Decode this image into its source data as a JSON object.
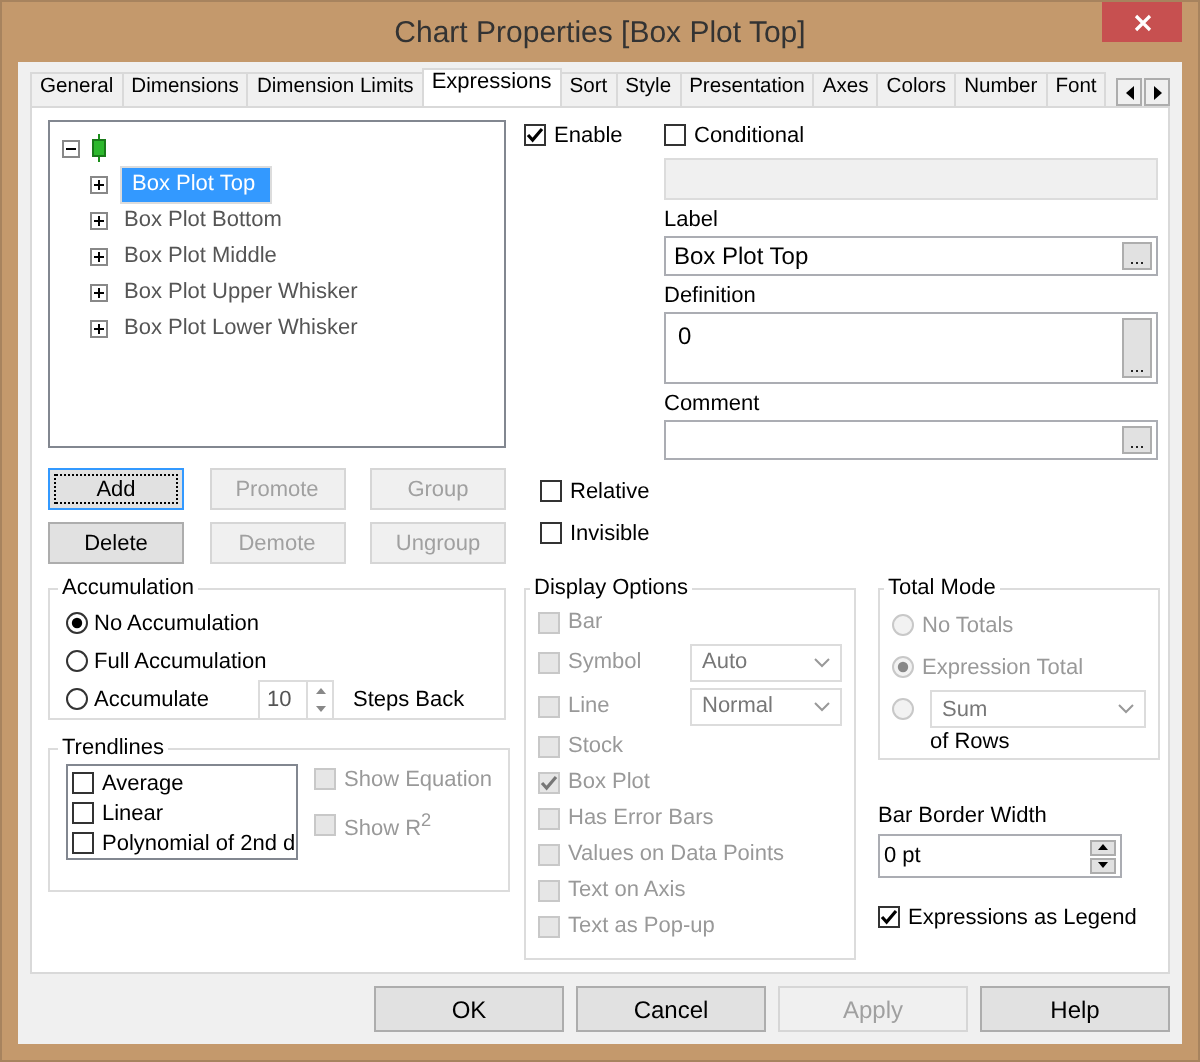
{
  "window": {
    "title": "Chart Properties [Box Plot Top]"
  },
  "tabs": [
    {
      "label": "General",
      "selected": false
    },
    {
      "label": "Dimensions",
      "selected": false
    },
    {
      "label": "Dimension Limits",
      "selected": false
    },
    {
      "label": "Expressions",
      "selected": true
    },
    {
      "label": "Sort",
      "selected": false
    },
    {
      "label": "Style",
      "selected": false
    },
    {
      "label": "Presentation",
      "selected": false
    },
    {
      "label": "Axes",
      "selected": false
    },
    {
      "label": "Colors",
      "selected": false
    },
    {
      "label": "Number",
      "selected": false
    },
    {
      "label": "Font",
      "selected": false
    }
  ],
  "tree": {
    "expanded": true,
    "children": [
      {
        "label": "Box Plot Top",
        "selected": true,
        "expanded": false
      },
      {
        "label": "Box Plot Bottom",
        "selected": false,
        "expanded": false
      },
      {
        "label": "Box Plot Middle",
        "selected": false,
        "expanded": false
      },
      {
        "label": "Box Plot Upper Whisker",
        "selected": false,
        "expanded": false
      },
      {
        "label": "Box Plot Lower Whisker",
        "selected": false,
        "expanded": false
      }
    ]
  },
  "expression_buttons": [
    {
      "label": "Add",
      "disabled": false,
      "focused": true
    },
    {
      "label": "Promote",
      "disabled": true,
      "focused": false
    },
    {
      "label": "Group",
      "disabled": true,
      "focused": false
    },
    {
      "label": "Delete",
      "disabled": false,
      "focused": false
    },
    {
      "label": "Demote",
      "disabled": true,
      "focused": false
    },
    {
      "label": "Ungroup",
      "disabled": true,
      "focused": false
    }
  ],
  "enable": {
    "label": "Enable",
    "checked": true
  },
  "conditional": {
    "label": "Conditional",
    "checked": false
  },
  "label_field": {
    "label": "Label",
    "value": "Box Plot Top",
    "button": "..."
  },
  "definition_field": {
    "label": "Definition",
    "value": "0",
    "button": "..."
  },
  "comment_field": {
    "label": "Comment",
    "button": "..."
  },
  "relative": {
    "label": "Relative",
    "checked": false
  },
  "invisible": {
    "label": "Invisible",
    "checked": false
  },
  "accumulation": {
    "title": "Accumulation",
    "options": [
      {
        "label": "No Accumulation",
        "selected": true
      },
      {
        "label": "Full Accumulation",
        "selected": false
      },
      {
        "label": "Accumulate",
        "selected": false
      }
    ],
    "steps": "10",
    "steps_label": "Steps Back"
  },
  "trendlines": {
    "title": "Trendlines",
    "items": [
      {
        "label": "Average",
        "checked": false
      },
      {
        "label": "Linear",
        "checked": false
      },
      {
        "label": "Polynomial of 2nd d",
        "checked": false
      }
    ],
    "options": [
      {
        "label": "Show Equation",
        "checked": false,
        "disabled": true
      },
      {
        "label": "Show R$^{2}$",
        "checked": false,
        "disabled": true
      }
    ]
  },
  "display_options": {
    "title": "Display Options",
    "items": [
      {
        "kind": "checkbox",
        "label": "Bar",
        "checked": false,
        "disabled": true
      },
      {
        "kind": "select",
        "label": "Symbol",
        "checked": false,
        "disabled": true,
        "value": "Auto"
      },
      {
        "kind": "select",
        "label": "Line",
        "checked": false,
        "disabled": true,
        "value": "Normal"
      },
      {
        "kind": "checkbox",
        "label": "Stock",
        "checked": false,
        "disabled": true
      },
      {
        "kind": "checkbox",
        "label": "Box Plot",
        "checked": true,
        "disabled": true
      },
      {
        "kind": "checkbox",
        "label": "Has Error Bars",
        "checked": false,
        "disabled": true
      },
      {
        "kind": "checkbox",
        "label": "Values on Data Points",
        "checked": false,
        "disabled": true
      },
      {
        "kind": "checkbox",
        "label": "Text on Axis",
        "checked": false,
        "disabled": true
      },
      {
        "kind": "checkbox",
        "label": "Text as Pop-up",
        "checked": false,
        "disabled": true
      }
    ]
  },
  "total_mode": {
    "title": "Total Mode",
    "options": [
      {
        "kind": "radio",
        "label": "No Totals",
        "selected": false,
        "disabled": true
      },
      {
        "kind": "radio",
        "label": "Expression Total",
        "selected": true,
        "disabled": true
      },
      {
        "kind": "select",
        "value": "Sum",
        "selected": false,
        "disabled": true
      }
    ],
    "caption": "of Rows"
  },
  "bar_border_width": {
    "label": "Bar Border Width",
    "value": "0 pt"
  },
  "expressions_as_legend": {
    "label": "Expressions as Legend",
    "checked": true
  },
  "dialog_buttons": [
    {
      "label": "OK",
      "disabled": false
    },
    {
      "label": "Cancel",
      "disabled": false
    },
    {
      "label": "Apply",
      "disabled": true
    },
    {
      "label": "Help",
      "disabled": false
    }
  ]
}
